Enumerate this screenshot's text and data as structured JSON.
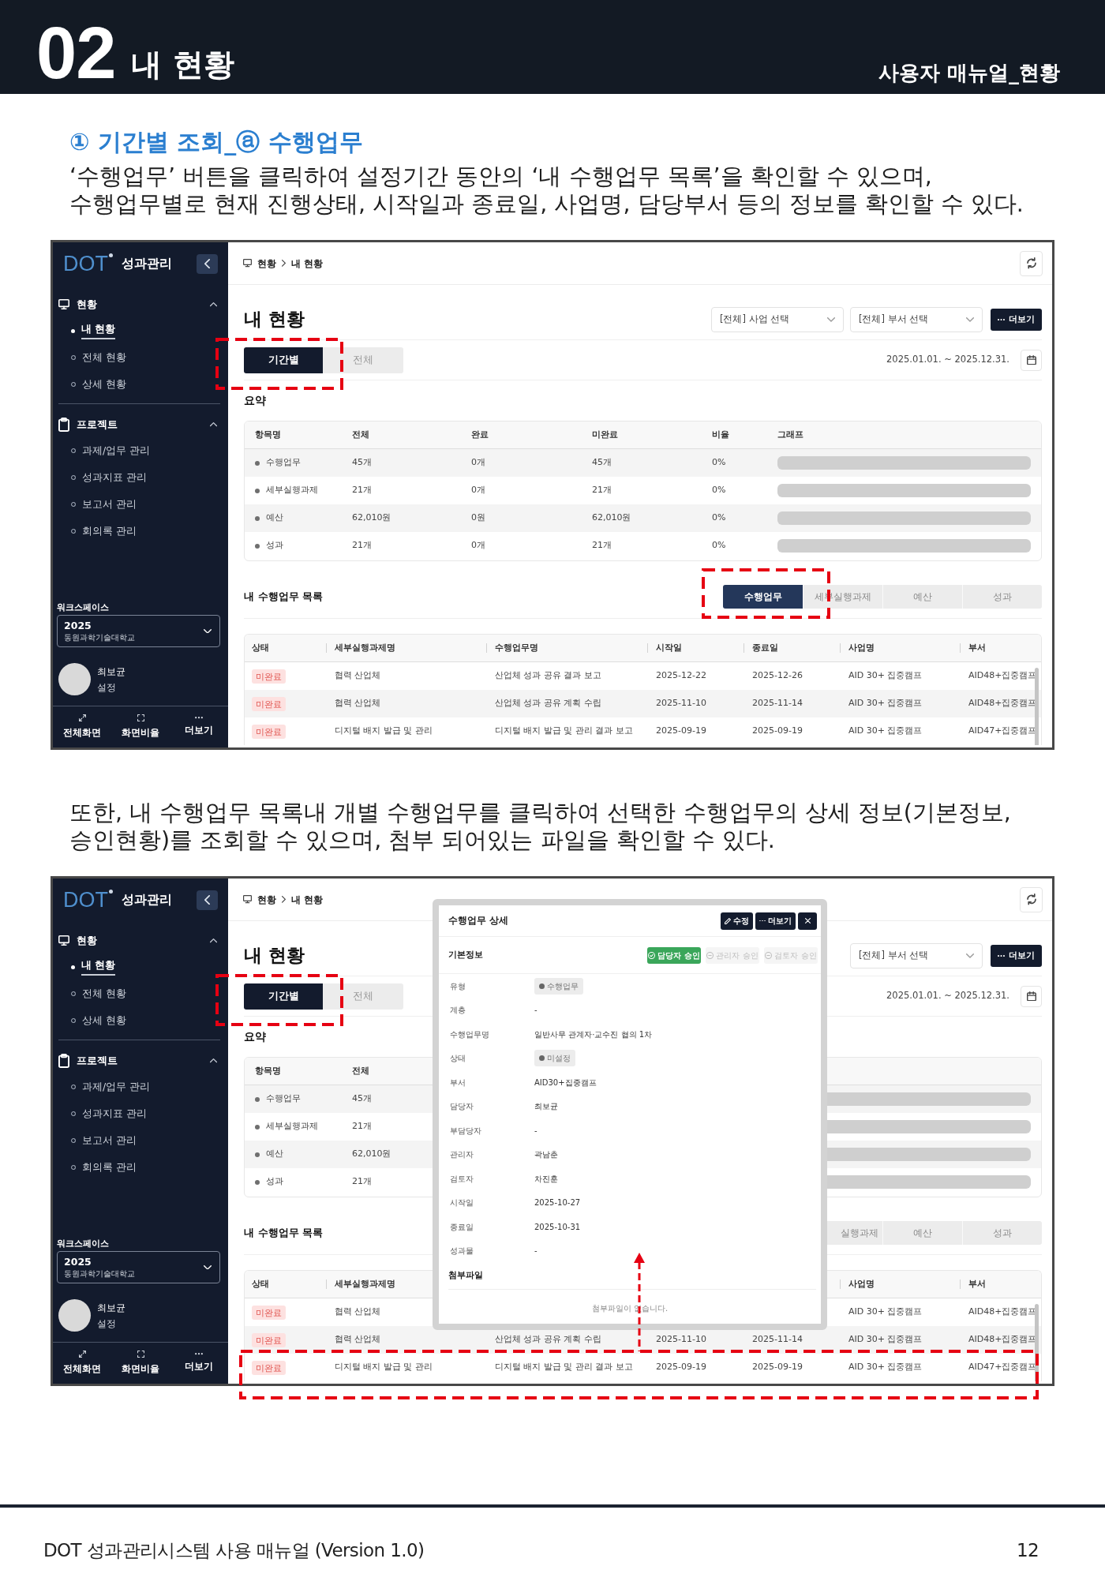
{
  "page_header": {
    "number": "02",
    "title": "내 현황",
    "subtitle": "사용자 매뉴얼_현황"
  },
  "sections": [
    {
      "heading": "① 기간별 조회_ⓐ 수행업무",
      "description": "‘수행업무’ 버튼을 클릭하여 설정기간 동안의 ‘내 수행업무 목록’을 확인할 수 있으며,\n수행업무별로 현재 진행상태, 시작일과 종료일, 사업명, 담당부서 등의 정보를 확인할 수 있다.",
      "screenshot": {
        "sidebar": {
          "logo": "DOT",
          "app_name": "성과관리",
          "groups": [
            {
              "label": "현황",
              "expanded": true,
              "items": [
                {
                  "label": "내 현황",
                  "selected": true
                },
                {
                  "label": "전체 현황",
                  "selected": false
                },
                {
                  "label": "상세 현황",
                  "selected": false
                }
              ]
            },
            {
              "label": "프로젝트",
              "expanded": true,
              "items": [
                {
                  "label": "과제/업무 관리",
                  "selected": false
                },
                {
                  "label": "성과지표 관리",
                  "selected": false
                },
                {
                  "label": "보고서 관리",
                  "selected": false
                },
                {
                  "label": "회의록 관리",
                  "selected": false
                }
              ]
            }
          ],
          "workspace": {
            "label": "워크스페이스",
            "year": "2025",
            "organization": "동원과학기술대학교"
          },
          "user": {
            "name": "최보균",
            "settings": "설정"
          },
          "footer_buttons": [
            "전체화면",
            "화면비율",
            "더보기"
          ]
        },
        "breadcrumb": [
          "현황",
          "내 현황"
        ],
        "title": "내 현황",
        "filters": [
          "[전체] 사업 선택",
          "[전체] 부서 선택"
        ],
        "more_button": "더보기",
        "view_tabs": [
          {
            "label": "기간별",
            "selected": true,
            "callout": true
          },
          {
            "label": "전체",
            "selected": false,
            "callout": false
          }
        ],
        "date_range": "2025.01.01. ~ 2025.12.31.",
        "summary": {
          "title": "요약",
          "columns": {
            "item": "항목명",
            "total": "전체",
            "done": "완료",
            "remaining": "미완료",
            "ratio": "비율",
            "graph": "그래프"
          },
          "rows": [
            {
              "item": "수행업무",
              "total": "45개",
              "done": "0개",
              "remaining": "45개",
              "ratio": "0%",
              "level": 0
            },
            {
              "item": "세부실행과제",
              "total": "21개",
              "done": "0개",
              "remaining": "21개",
              "ratio": "0%",
              "level": 0
            },
            {
              "item": "예산",
              "total": "62,010원",
              "done": "0원",
              "remaining": "62,010원",
              "ratio": "0%",
              "level": 0
            },
            {
              "item": "성과",
              "total": "21개",
              "done": "0개",
              "remaining": "21개",
              "ratio": "0%",
              "level": 0
            }
          ]
        },
        "task_list": {
          "title": "내 수행업무 목록",
          "tabs": [
            {
              "label": "수행업무",
              "selected": true,
              "callout": true
            },
            {
              "label": "세부실행과제",
              "selected": false,
              "callout": false
            },
            {
              "label": "예산",
              "selected": false,
              "callout": false
            },
            {
              "label": "성과",
              "selected": false,
              "callout": false
            }
          ],
          "columns": {
            "status": "상태",
            "subtask": "세부실행과제명",
            "task": "수행업무명",
            "start": "시작일",
            "end": "종료일",
            "business": "사업명",
            "department": "부서"
          },
          "rows": [
            {
              "status": "미완료",
              "subtask": "협력 산업체",
              "task": "산업체 성과 공유 결과 보고",
              "start": "2025-12-22",
              "end": "2025-12-26",
              "business": "AID 30+ 집중캠프",
              "department": "AID48+집중캠프",
              "callout": false
            },
            {
              "status": "미완료",
              "subtask": "협력 산업체",
              "task": "산업체 성과 공유 계획 수립",
              "start": "2025-11-10",
              "end": "2025-11-14",
              "business": "AID 30+ 집중캠프",
              "department": "AID48+집중캠프",
              "callout": false
            },
            {
              "status": "미완료",
              "subtask": "디지털 배지 발급 및 관리",
              "task": "디지털 배지 발급 및 관리 결과 보고",
              "start": "2025-09-19",
              "end": "2025-09-19",
              "business": "AID 30+ 집중캠프",
              "department": "AID47+집중캠프",
              "callout": false
            }
          ]
        }
      }
    },
    {
      "description": "또한, 내 수행업무 목록내 개별 수행업무를 클릭하여 선택한 수행업무의 상세 정보(기본정보,\n승인현황)를 조회할 수 있으며, 첨부 되어있는 파일을 확인할 수 있다.",
      "screenshot": {
        "sidebar": {
          "logo": "DOT",
          "app_name": "성과관리",
          "groups": [
            {
              "label": "현황",
              "expanded": true,
              "items": [
                {
                  "label": "내 현황",
                  "selected": true
                },
                {
                  "label": "전체 현황",
                  "selected": false
                },
                {
                  "label": "상세 현황",
                  "selected": false
                }
              ]
            },
            {
              "label": "프로젝트",
              "expanded": true,
              "items": [
                {
                  "label": "과제/업무 관리",
                  "selected": false
                },
                {
                  "label": "성과지표 관리",
                  "selected": false
                },
                {
                  "label": "보고서 관리",
                  "selected": false
                },
                {
                  "label": "회의록 관리",
                  "selected": false
                }
              ]
            }
          ],
          "workspace": {
            "label": "워크스페이스",
            "year": "2025",
            "organization": "동원과학기술대학교"
          },
          "user": {
            "name": "최보균",
            "settings": "설정"
          },
          "footer_buttons": [
            "전체화면",
            "화면비율",
            "더보기"
          ]
        },
        "breadcrumb": [
          "현황",
          "내 현황"
        ],
        "title": "내 현황",
        "filters": [
          "[전체] 부서 선택"
        ],
        "more_button": "더보기",
        "view_tabs": [
          {
            "label": "기간별",
            "selected": true,
            "callout": true
          },
          {
            "label": "전체",
            "selected": false,
            "callout": false
          }
        ],
        "date_range": "2025.01.01. ~ 2025.12.31.",
        "summary": {
          "title": "요약",
          "columns": {
            "item": "항목명",
            "total": "전체"
          },
          "rows": [
            {
              "item": "수행업무",
              "total": "45개",
              "level": 0
            },
            {
              "item": "세부실행과제",
              "total": "21개",
              "level": 0
            },
            {
              "item": "예산",
              "total": "62,010원",
              "level": 0
            },
            {
              "item": "성과",
              "total": "21개",
              "level": 0
            }
          ]
        },
        "task_list": {
          "title": "내 수행업무 목록",
          "tabs": [
            {
              "label": "실행과제",
              "selected": false,
              "clipped": true,
              "callout": false
            },
            {
              "label": "예산",
              "selected": false,
              "clipped": false,
              "callout": false
            },
            {
              "label": "성과",
              "selected": false,
              "clipped": false,
              "callout": false
            }
          ],
          "columns": {
            "status": "상태",
            "subtask": "세부실행과제명",
            "business": "사업명",
            "department": "부서"
          },
          "rows": [
            {
              "status": "미완료",
              "subtask": "협력 산업체",
              "business": "AID 30+ 집중캠프",
              "department": "AID48+집중캠프",
              "callout": false
            },
            {
              "status": "미완료",
              "subtask": "협력 산업체",
              "task": "산업체 성과 공유 계획 수립",
              "start": "2025-11-10",
              "end": "2025-11-14",
              "business": "AID 30+ 집중캠프",
              "department": "AID48+집중캠프",
              "callout": false
            },
            {
              "status": "미완료",
              "subtask": "디지털 배지 발급 및 관리",
              "task": "디지털 배지 발급 및 관리 결과 보고",
              "start": "2025-09-19",
              "end": "2025-09-19",
              "business": "AID 30+ 집중캠프",
              "department": "AID47+집중캠프",
              "callout": true
            }
          ]
        },
        "detail_modal": {
          "title": "수행업무 상세",
          "buttons": [
            "수정",
            "더보기"
          ],
          "section_title": "기본정보",
          "approvals": [
            {
              "label": "담당자 승인",
              "approved": true
            },
            {
              "label": "관리자 승인",
              "approved": false
            },
            {
              "label": "검토자 승인",
              "approved": false
            }
          ],
          "fields": [
            {
              "label": "유형",
              "value": "수행업무",
              "kind": "badge"
            },
            {
              "label": "계층",
              "value": "-",
              "kind": "text"
            },
            {
              "label": "수행업무명",
              "value": "일반사무 관계자·교수진 협의 1차",
              "kind": "text"
            },
            {
              "label": "상태",
              "value": "미설정",
              "kind": "badge"
            },
            {
              "label": "부서",
              "value": "AID30+집중캠프",
              "kind": "text"
            },
            {
              "label": "담당자",
              "value": "최보균",
              "kind": "text"
            },
            {
              "label": "부담당자",
              "value": "-",
              "kind": "text"
            },
            {
              "label": "관리자",
              "value": "곽남춘",
              "kind": "text"
            },
            {
              "label": "검토자",
              "value": "차진훈",
              "kind": "text"
            },
            {
              "label": "시작일",
              "value": "2025-10-27",
              "kind": "text"
            },
            {
              "label": "종료일",
              "value": "2025-10-31",
              "kind": "text"
            },
            {
              "label": "성과물",
              "value": "-",
              "kind": "text"
            }
          ],
          "attachments": {
            "title": "첨부파일",
            "empty_text": "첨부파일이 없습니다."
          }
        }
      }
    }
  ],
  "footer": {
    "title": "DOT 성과관리시스템 사용 매뉴얼 (Version 1.0)",
    "page": "12"
  }
}
